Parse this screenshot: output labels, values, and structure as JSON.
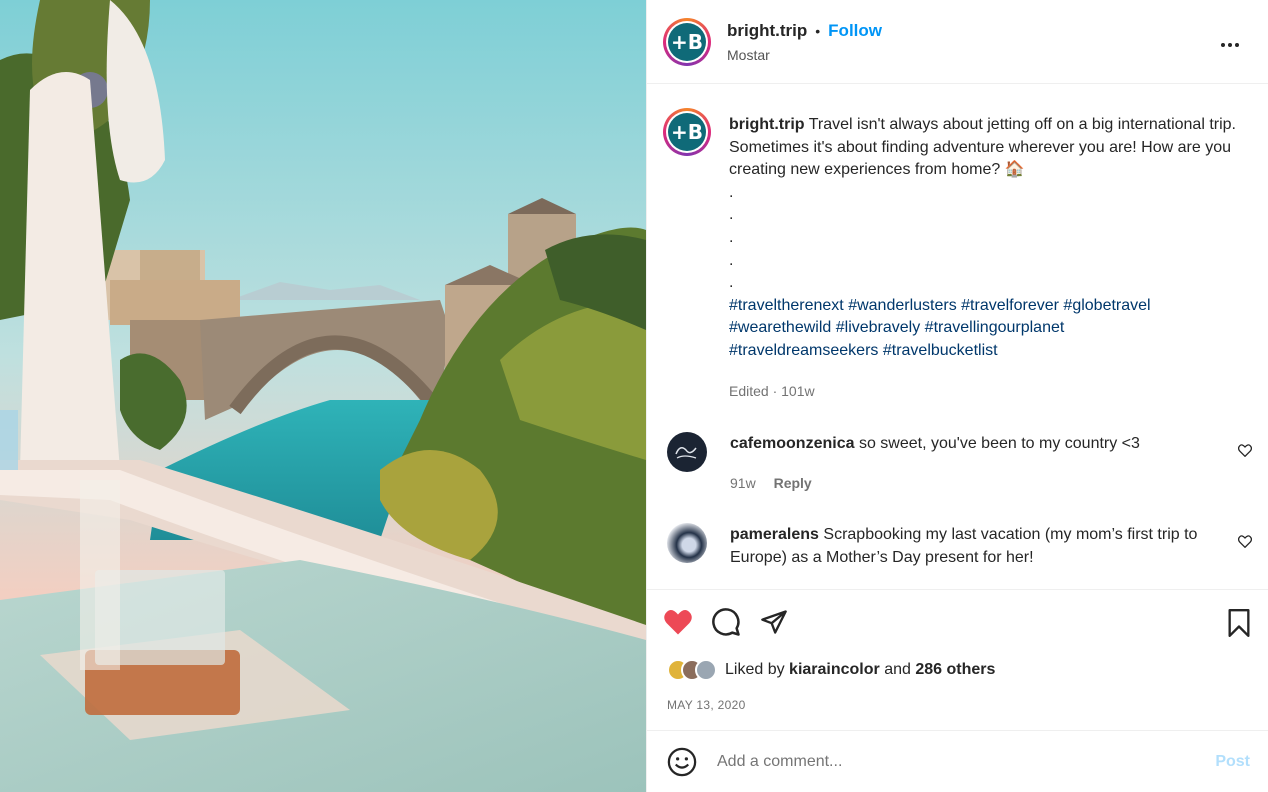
{
  "post": {
    "username": "bright.trip",
    "follow_label": "Follow",
    "location": "Mostar",
    "more_label": "•••",
    "avatar_letter": "+B"
  },
  "caption": {
    "username": "bright.trip",
    "text": "Travel isn't always about jetting off on a big international trip. Sometimes it's about finding adventure wherever you are! How are you creating new experiences from home?",
    "emoji": "🏠",
    "dots": [
      ".",
      ".",
      ".",
      ".",
      "."
    ],
    "hashtags_line1": [
      "#traveltherenext",
      "#wanderlusters",
      "#travelforever",
      "#globetravel"
    ],
    "hashtags_line2": [
      "#wearethewild",
      "#livebravely",
      "#travellingourplanet"
    ],
    "hashtags_line3": [
      "#traveldreamseekers",
      "#travelbucketlist"
    ],
    "edited": "Edited · 101w"
  },
  "comments": [
    {
      "username": "cafemoonzenica",
      "text": "so sweet, you've been to my country <3",
      "age": "91w",
      "reply_label": "Reply"
    },
    {
      "username": "pameralens",
      "text": "Scrapbooking my last vacation (my mom’s first trip to Europe) as a Mother’s Day present for her!"
    }
  ],
  "likes": {
    "prefix": "Liked by",
    "user": "kiaraincolor",
    "and": "and",
    "others": "286 others"
  },
  "date": "MAY 13, 2020",
  "add_comment": {
    "placeholder": "Add a comment...",
    "post_label": "Post"
  },
  "colors": {
    "link": "#0095f6",
    "hashtag": "#00376b",
    "like_red": "#ed4956",
    "post_disabled": "#b2dffc"
  },
  "icons": [
    "heart-icon",
    "comment-icon",
    "share-icon",
    "bookmark-icon",
    "emoji-icon",
    "more-icon"
  ]
}
